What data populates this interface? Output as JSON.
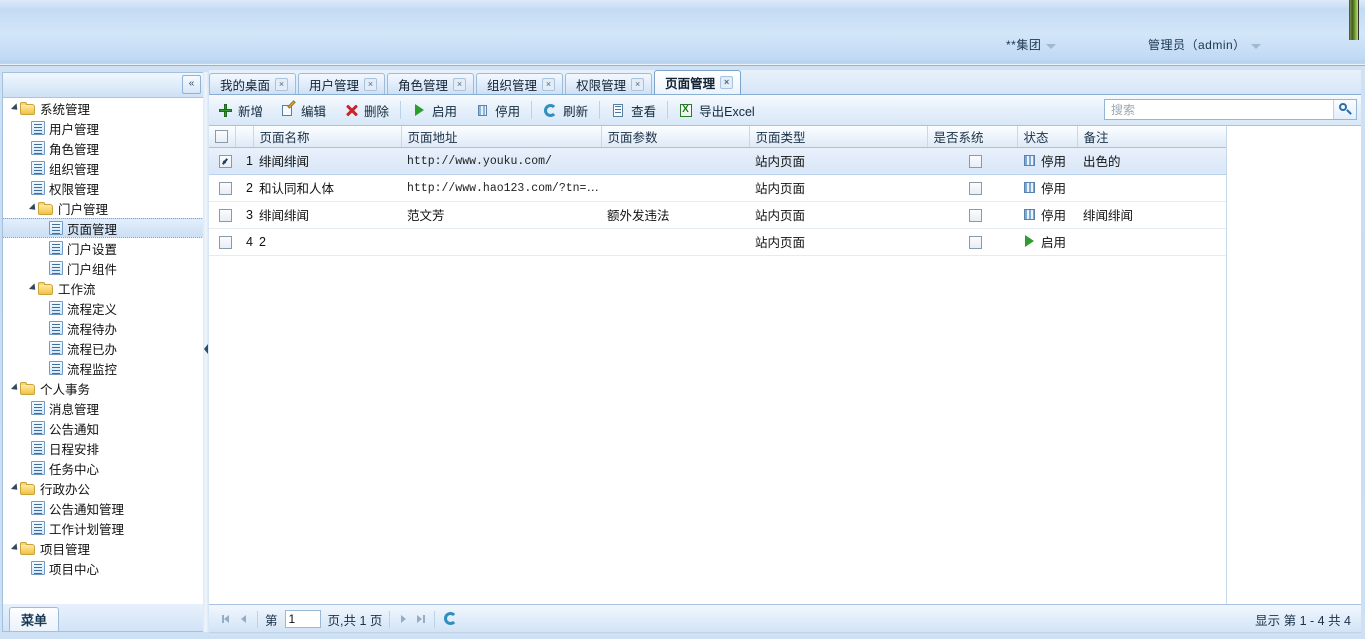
{
  "header": {
    "org_label": "**集团",
    "user_label": "管理员（admin）",
    "org_caret": "chevron-down-icon",
    "user_caret": "chevron-down-icon"
  },
  "sidebar": {
    "collapse_label": "«",
    "menu_button_label": "菜单",
    "tree": [
      {
        "label": "系统管理",
        "type": "folder",
        "depth": 0,
        "selected": false
      },
      {
        "label": "用户管理",
        "type": "page",
        "depth": 1,
        "selected": false
      },
      {
        "label": "角色管理",
        "type": "page",
        "depth": 1,
        "selected": false
      },
      {
        "label": "组织管理",
        "type": "page",
        "depth": 1,
        "selected": false
      },
      {
        "label": "权限管理",
        "type": "page",
        "depth": 1,
        "selected": false
      },
      {
        "label": "门户管理",
        "type": "folder",
        "depth": 1,
        "selected": false
      },
      {
        "label": "页面管理",
        "type": "page",
        "depth": 2,
        "selected": true
      },
      {
        "label": "门户设置",
        "type": "page",
        "depth": 2,
        "selected": false
      },
      {
        "label": "门户组件",
        "type": "page",
        "depth": 2,
        "selected": false
      },
      {
        "label": "工作流",
        "type": "folder",
        "depth": 1,
        "selected": false
      },
      {
        "label": "流程定义",
        "type": "page",
        "depth": 2,
        "selected": false
      },
      {
        "label": "流程待办",
        "type": "page",
        "depth": 2,
        "selected": false
      },
      {
        "label": "流程已办",
        "type": "page",
        "depth": 2,
        "selected": false
      },
      {
        "label": "流程监控",
        "type": "page",
        "depth": 2,
        "selected": false
      },
      {
        "label": "个人事务",
        "type": "folder",
        "depth": 0,
        "selected": false
      },
      {
        "label": "消息管理",
        "type": "page",
        "depth": 1,
        "selected": false
      },
      {
        "label": "公告通知",
        "type": "page",
        "depth": 1,
        "selected": false
      },
      {
        "label": "日程安排",
        "type": "page",
        "depth": 1,
        "selected": false
      },
      {
        "label": "任务中心",
        "type": "page",
        "depth": 1,
        "selected": false
      },
      {
        "label": "行政办公",
        "type": "folder",
        "depth": 0,
        "selected": false
      },
      {
        "label": "公告通知管理",
        "type": "page",
        "depth": 1,
        "selected": false
      },
      {
        "label": "工作计划管理",
        "type": "page",
        "depth": 1,
        "selected": false
      },
      {
        "label": "项目管理",
        "type": "folder",
        "depth": 0,
        "selected": false
      },
      {
        "label": "项目中心",
        "type": "page",
        "depth": 1,
        "selected": false
      }
    ]
  },
  "tabs": {
    "close_glyph": "×",
    "items": [
      {
        "label": "我的桌面",
        "active": false
      },
      {
        "label": "用户管理",
        "active": false
      },
      {
        "label": "角色管理",
        "active": false
      },
      {
        "label": "组织管理",
        "active": false
      },
      {
        "label": "权限管理",
        "active": false
      },
      {
        "label": "页面管理",
        "active": true
      }
    ]
  },
  "toolbar": {
    "buttons": [
      {
        "label": "新增",
        "icon": "plus-icon"
      },
      {
        "label": "编辑",
        "icon": "edit-icon"
      },
      {
        "label": "删除",
        "icon": "delete-icon"
      },
      {
        "label": "启用",
        "icon": "play-icon"
      },
      {
        "label": "停用",
        "icon": "pause-icon"
      },
      {
        "label": "刷新",
        "icon": "refresh-icon"
      },
      {
        "label": "查看",
        "icon": "view-icon"
      },
      {
        "label": "导出Excel",
        "icon": "excel-icon"
      }
    ],
    "search_placeholder": "搜索",
    "search_value": ""
  },
  "grid": {
    "columns": [
      {
        "key": "check",
        "label": ""
      },
      {
        "key": "num",
        "label": ""
      },
      {
        "key": "name",
        "label": "页面名称"
      },
      {
        "key": "url",
        "label": "页面地址"
      },
      {
        "key": "param",
        "label": "页面参数"
      },
      {
        "key": "type",
        "label": "页面类型"
      },
      {
        "key": "system",
        "label": "是否系统"
      },
      {
        "key": "status",
        "label": "状态"
      },
      {
        "key": "remark",
        "label": "备注"
      }
    ],
    "header_checked": false,
    "rows": [
      {
        "num": "1",
        "checked": true,
        "selected": true,
        "name": "绯闻绯闻",
        "url": "http://www.youku.com/",
        "param": "",
        "type": "站内页面",
        "system": false,
        "status": "停用",
        "status_icon": "pause-icon",
        "remark": "出色的"
      },
      {
        "num": "2",
        "checked": false,
        "selected": false,
        "name": "和认同和人体",
        "url": "http://www.hao123.com/?tn=...",
        "param": "",
        "type": "站内页面",
        "system": false,
        "status": "停用",
        "status_icon": "pause-icon",
        "remark": ""
      },
      {
        "num": "3",
        "checked": false,
        "selected": false,
        "name": "绯闻绯闻",
        "url": "范文芳",
        "param": "额外发违法",
        "type": "站内页面",
        "system": false,
        "status": "停用",
        "status_icon": "pause-icon",
        "remark": "绯闻绯闻"
      },
      {
        "num": "4",
        "checked": false,
        "selected": false,
        "name": "2",
        "url": "",
        "param": "",
        "type": "站内页面",
        "system": false,
        "status": "启用",
        "status_icon": "play-icon",
        "remark": ""
      }
    ]
  },
  "pager": {
    "first_icon": "first-page-icon",
    "prev_icon": "prev-page-icon",
    "next_icon": "next-page-icon",
    "last_icon": "last-page-icon",
    "reload_icon": "refresh-icon",
    "prefix_label": "第",
    "page_value": "1",
    "suffix_label": "页,共 1 页",
    "info_label": "显示 第 1 - 4 共 4"
  },
  "colors": {
    "accent": "#2b6ea8",
    "banner": "#c5dcf4",
    "selection": "#d8e6f7",
    "enabled": "#2f9c2f",
    "disabled": "#7fa9d2"
  }
}
